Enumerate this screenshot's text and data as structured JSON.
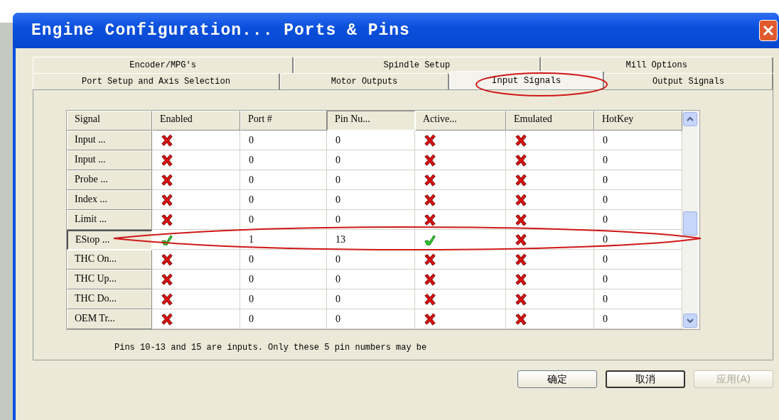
{
  "window": {
    "title": "Engine Configuration... Ports & Pins"
  },
  "tab_rows": [
    [
      {
        "label": "Encoder/MPG's",
        "selected": false
      },
      {
        "label": "Spindle Setup",
        "selected": false
      },
      {
        "label": "Mill Options",
        "selected": false
      }
    ],
    [
      {
        "label": "Port Setup and Axis Selection",
        "selected": false
      },
      {
        "label": "Motor Outputs",
        "selected": false
      },
      {
        "label": "Input Signals",
        "selected": true
      },
      {
        "label": "Output Signals",
        "selected": false
      }
    ]
  ],
  "table": {
    "columns": [
      "Signal",
      "Enabled",
      "Port #",
      "Pin Nu...",
      "Active...",
      "Emulated",
      "HotKey"
    ],
    "rows": [
      {
        "signal": "Input ...",
        "enabled": false,
        "port": "0",
        "pin": "0",
        "active_low": false,
        "emulated": false,
        "hotkey": "0",
        "selected": false
      },
      {
        "signal": "Input ...",
        "enabled": false,
        "port": "0",
        "pin": "0",
        "active_low": false,
        "emulated": false,
        "hotkey": "0",
        "selected": false
      },
      {
        "signal": "Probe ...",
        "enabled": false,
        "port": "0",
        "pin": "0",
        "active_low": false,
        "emulated": false,
        "hotkey": "0",
        "selected": false
      },
      {
        "signal": "Index ...",
        "enabled": false,
        "port": "0",
        "pin": "0",
        "active_low": false,
        "emulated": false,
        "hotkey": "0",
        "selected": false
      },
      {
        "signal": "Limit ...",
        "enabled": false,
        "port": "0",
        "pin": "0",
        "active_low": false,
        "emulated": false,
        "hotkey": "0",
        "selected": false
      },
      {
        "signal": "EStop ...",
        "enabled": true,
        "port": "1",
        "pin": "13",
        "active_low": true,
        "emulated": false,
        "hotkey": "0",
        "selected": true
      },
      {
        "signal": "THC On...",
        "enabled": false,
        "port": "0",
        "pin": "0",
        "active_low": false,
        "emulated": false,
        "hotkey": "0",
        "selected": false
      },
      {
        "signal": "THC Up...",
        "enabled": false,
        "port": "0",
        "pin": "0",
        "active_low": false,
        "emulated": false,
        "hotkey": "0",
        "selected": false
      },
      {
        "signal": "THC Do...",
        "enabled": false,
        "port": "0",
        "pin": "0",
        "active_low": false,
        "emulated": false,
        "hotkey": "0",
        "selected": false
      },
      {
        "signal": "OEM Tr...",
        "enabled": false,
        "port": "0",
        "pin": "0",
        "active_low": false,
        "emulated": false,
        "hotkey": "0",
        "selected": false
      }
    ]
  },
  "note": "Pins 10-13 and 15 are inputs. Only these 5 pin numbers may be",
  "buttons": [
    {
      "label": "确定",
      "default": false,
      "disabled": false
    },
    {
      "label": "取消",
      "default": true,
      "disabled": false
    },
    {
      "label": "应用(A)",
      "default": false,
      "disabled": true
    }
  ]
}
